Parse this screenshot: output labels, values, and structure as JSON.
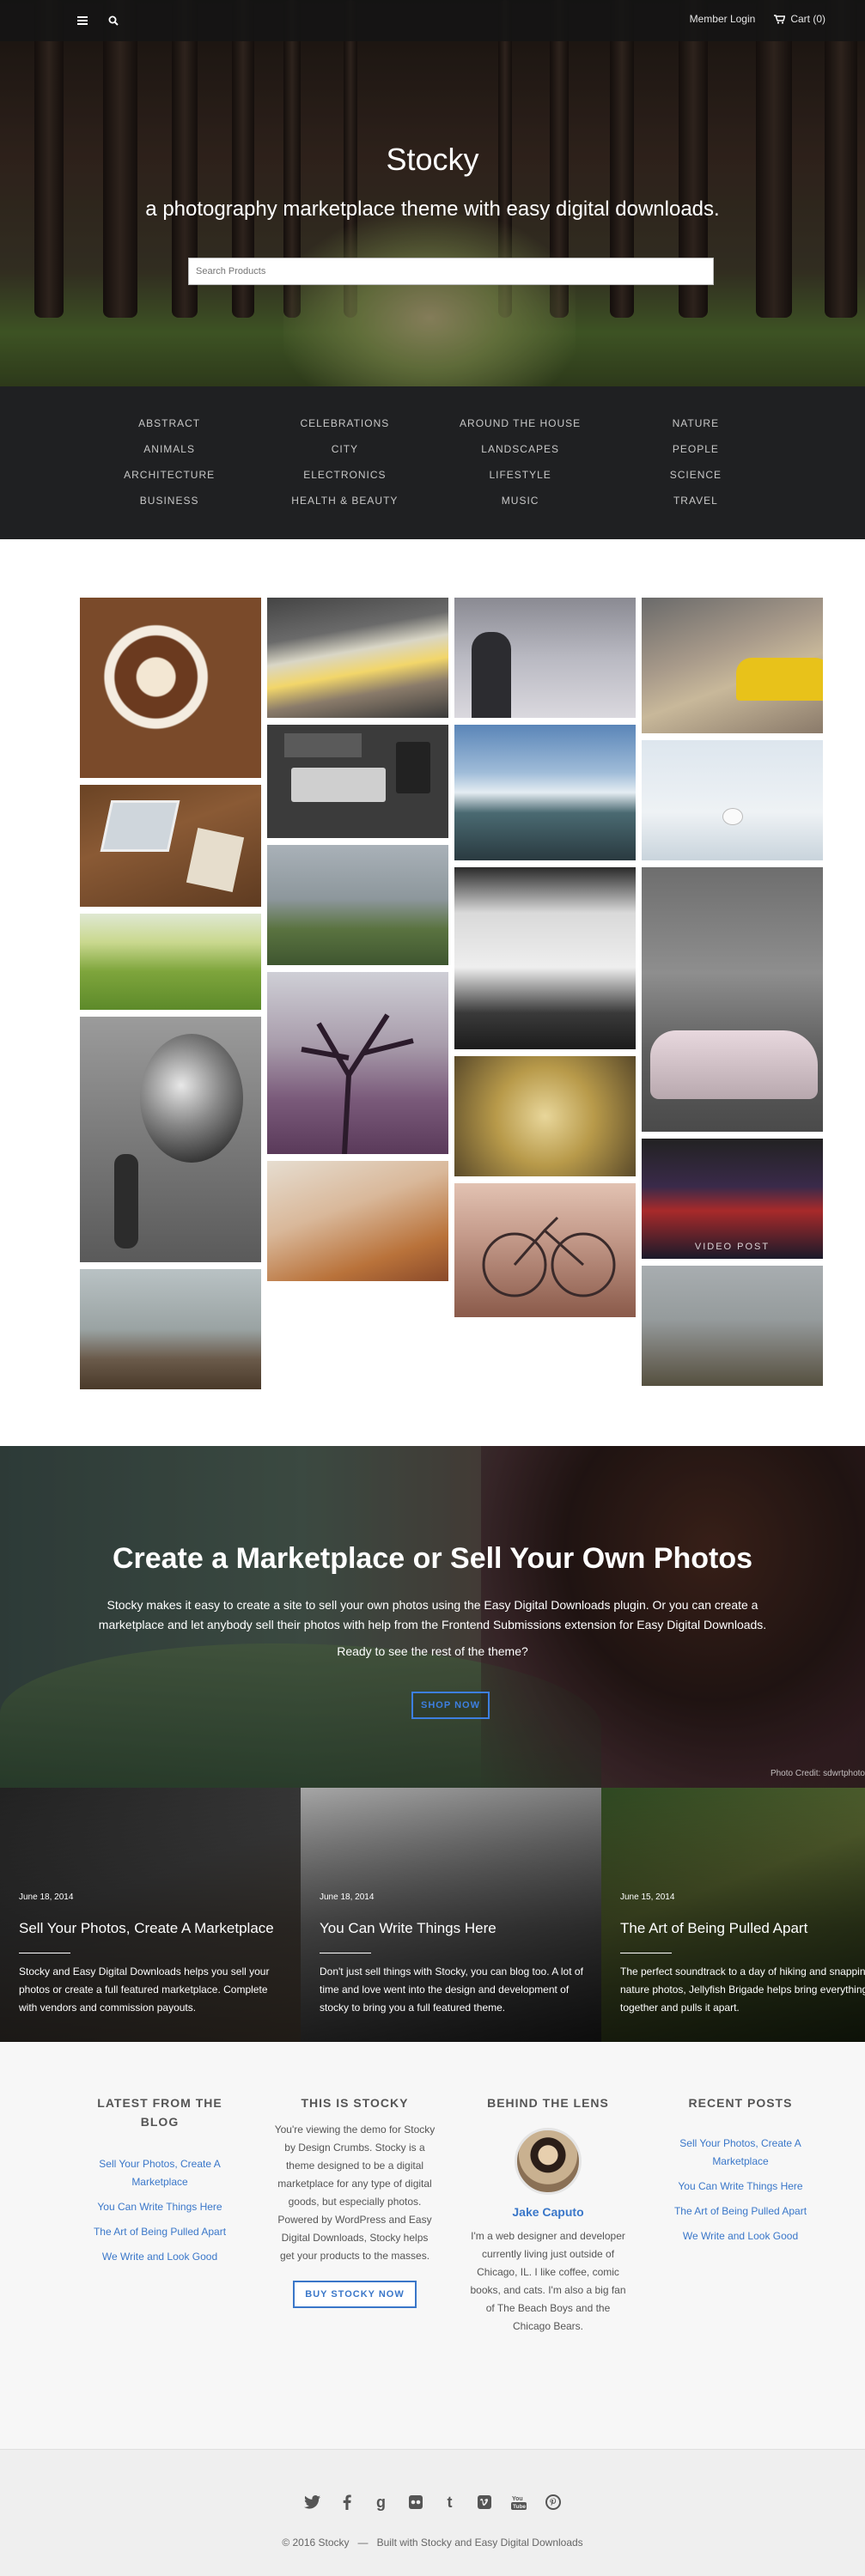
{
  "topbar": {
    "menu_icon": "hamburger-menu-icon",
    "search_icon": "search-icon",
    "member_login": "Member Login",
    "cart_icon": "cart-icon",
    "cart": "Cart (0)"
  },
  "hero": {
    "title": "Stocky",
    "tagline": "a photography marketplace theme with easy digital downloads.",
    "search_placeholder": "Search Products"
  },
  "categories": [
    "ABSTRACT",
    "CELEBRATIONS",
    "AROUND THE HOUSE",
    "NATURE",
    "ANIMALS",
    "CITY",
    "LANDSCAPES",
    "PEOPLE",
    "ARCHITECTURE",
    "ELECTRONICS",
    "LIFESTYLE",
    "SCIENCE",
    "BUSINESS",
    "HEALTH & BEAUTY",
    "MUSIC",
    "TRAVEL"
  ],
  "gallery": {
    "video_label": "VIDEO POST"
  },
  "cta": {
    "title": "Create a Marketplace or Sell Your Own Photos",
    "description": "Stocky makes it easy to create a site to sell your own photos using the Easy Digital Downloads plugin. Or you can create a marketplace and let anybody sell their photos with help from the Frontend Submissions extension for Easy Digital Downloads.",
    "ready": "Ready to see the rest of the theme?",
    "button": "SHOP NOW",
    "credit": "Photo Credit: sdwrtphoto"
  },
  "posts": [
    {
      "date": "June 18, 2014",
      "title": "Sell Your Photos, Create A Marketplace",
      "excerpt": "Stocky and Easy Digital Downloads helps you sell your photos or create a full featured marketplace. Complete with vendors and commission payouts."
    },
    {
      "date": "June 18, 2014",
      "title": "You Can Write Things Here",
      "excerpt": "Don't just sell things with Stocky, you can blog too. A lot of time and love went into the design and development of stocky to bring you a full featured theme."
    },
    {
      "date": "June 15, 2014",
      "title": "The Art of Being Pulled Apart",
      "excerpt": "The perfect soundtrack to a day of hiking and snapping nature photos, Jellyfish Brigade helps bring everything together and pulls it apart."
    }
  ],
  "widgets": {
    "blog": {
      "title": "LATEST FROM THE BLOG",
      "links": [
        "Sell Your Photos, Create A Marketplace",
        "You Can Write Things Here",
        "The Art of Being Pulled Apart",
        "We Write and Look Good"
      ]
    },
    "about": {
      "title": "THIS IS STOCKY",
      "text": "You're viewing the demo for Stocky by Design Crumbs. Stocky is a theme designed to be a digital marketplace for any type of digital goods, but especially photos. Powered by WordPress and Easy Digital Downloads, Stocky helps get your products to the masses.",
      "button": "BUY STOCKY NOW"
    },
    "lens": {
      "title": "BEHIND THE LENS",
      "name": "Jake Caputo",
      "bio": "I'm a web designer and developer currently living just outside of Chicago, IL. I like coffee, comic books, and cats. I'm also a big fan of The Beach Boys and the Chicago Bears."
    },
    "recent": {
      "title": "RECENT POSTS",
      "links": [
        "Sell Your Photos, Create A Marketplace",
        "You Can Write Things Here",
        "The Art of Being Pulled Apart",
        "We Write and Look Good"
      ]
    }
  },
  "footer": {
    "social_icons": [
      "twitter-icon",
      "facebook-icon",
      "google-plus-icon",
      "flickr-icon",
      "tumblr-icon",
      "vimeo-icon",
      "youtube-icon",
      "pinterest-icon"
    ],
    "copyright": "© 2016 Stocky",
    "separator": "—",
    "credit": "Built with Stocky and Easy Digital Downloads"
  }
}
